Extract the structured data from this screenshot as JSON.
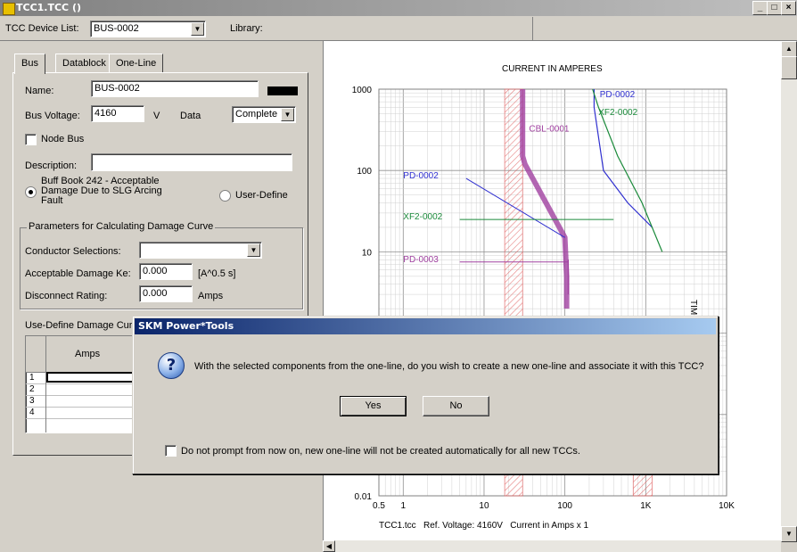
{
  "window": {
    "title": "TCC1.TCC ()"
  },
  "toolbar": {
    "device_list_label": "TCC Device List:",
    "device_list_value": "BUS-0002",
    "library_label": "Library:"
  },
  "tabs": [
    "Bus",
    "Datablock",
    "One-Line"
  ],
  "bus_form": {
    "name_label": "Name:",
    "name_value": "BUS-0002",
    "voltage_label": "Bus Voltage:",
    "voltage_value": "4160",
    "voltage_unit": "V",
    "data_label": "Data",
    "data_value": "Complete",
    "node_bus_label": "Node Bus",
    "description_label": "Description:",
    "description_value": "",
    "radio_buff_label": "Buff Book 242 - Acceptable Damage Due to SLG Arcing Fault",
    "radio_user_label": "User-Define",
    "group_title": "Parameters for Calculating Damage Curve",
    "conductor_label": "Conductor Selections:",
    "conductor_value": "",
    "ke_label": "Acceptable Damage Ke:",
    "ke_value": "0.000",
    "ke_unit": "[A^0.5 s]",
    "disconnect_label": "Disconnect Rating:",
    "disconnect_value": "0.000",
    "disconnect_unit": "Amps",
    "user_curve_title": "Use-Define Damage Cur",
    "grid_header": "Amps",
    "grid_rows": [
      "1",
      "2",
      "3",
      "4"
    ]
  },
  "chart_data": {
    "type": "line",
    "title": "CURRENT IN AMPERES",
    "ylabel": "TIME IN SECONDS",
    "xscale": "log",
    "yscale": "log",
    "xlim": [
      0.5,
      10000
    ],
    "ylim": [
      0.01,
      1000
    ],
    "x_ticks": [
      "0.5",
      "1",
      "10",
      "100",
      "1K",
      "10K"
    ],
    "y_ticks": [
      "1000",
      "100",
      "10",
      "0.01"
    ],
    "footer": "TCC1.tcc   Ref. Voltage: 4160V   Current in Amps x 1",
    "curves": [
      {
        "name": "CBL-0001",
        "color": "#a040a0",
        "x": [
          30,
          30,
          32,
          100,
          105,
          105
        ],
        "y": [
          1000,
          150,
          120,
          15,
          5,
          2
        ]
      },
      {
        "name": "PD-0002",
        "color": "#3030d0",
        "x": [
          230,
          230,
          300,
          600,
          1200
        ],
        "y": [
          1000,
          600,
          100,
          40,
          20
        ]
      },
      {
        "name": "XF2-0002",
        "color": "#1a8a3a",
        "x": [
          220,
          260,
          450,
          900,
          1600
        ],
        "y": [
          1000,
          600,
          150,
          40,
          10
        ]
      },
      {
        "name": "PD-0003",
        "color": "#a040a0",
        "x": [
          110,
          110
        ],
        "y": [
          8,
          3
        ]
      }
    ],
    "shaded_regions": [
      {
        "color": "#e06060",
        "x": [
          18,
          30
        ],
        "y": [
          0.01,
          1000
        ]
      },
      {
        "color": "#e06060",
        "x": [
          700,
          1200
        ],
        "y": [
          0.01,
          0.05
        ]
      }
    ],
    "labels": [
      "PD-0002",
      "XF2-0002",
      "CBL-0001",
      "PD-0002",
      "XF2-0002",
      "PD-0003"
    ],
    "colors": {
      "pd": "#3030d0",
      "xf": "#1a8a3a",
      "cbl": "#a040a0"
    }
  },
  "dialog": {
    "title": "SKM Power*Tools",
    "message": "With the selected components from the one-line, do you wish to create a new one-line and associate it with this TCC?",
    "yes_label": "Yes",
    "no_label": "No",
    "checkbox_label": "Do not prompt from now on, new one-line will not be created automatically for all new TCCs."
  }
}
